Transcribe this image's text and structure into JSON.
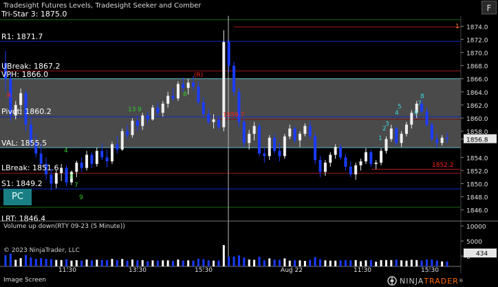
{
  "header": {
    "title": "Tradesight Futures Levels, Tradesight Seeker and Comber",
    "f_button": "F"
  },
  "pc_button": "PC",
  "volume_panel": {
    "title": "Volume up down(RTY 09-23 (5 Minute))",
    "axis_labels": [
      "10000",
      "5000",
      "0"
    ],
    "current_volume": "434"
  },
  "copyright": "© 2023 NinjaTrader, LLC",
  "footer": {
    "image_screen": "Image Screen",
    "brand_part_a": "NINJA",
    "brand_part_b": "TRADER",
    "brand_tm": "®"
  },
  "colors": {
    "background": "#000000",
    "band_fill": "#4a4a4a",
    "band_line": "#5fb9c9",
    "red_line": "#9a1a1a",
    "blue_line": "#0a2cc8",
    "green_line": "#1a6a1a",
    "bar_up": "#f0f0f0",
    "bar_down": "#1a3cff",
    "seeker_green": "#2ecc2e",
    "seeker_cyan": "#3ad7e0",
    "label_red": "#ff2020"
  },
  "levels": [
    {
      "label": "Tri-Star 3: 1875.0",
      "color": "green"
    },
    {
      "label": "R1: 1871.7",
      "color": "blue"
    },
    {
      "label": "UBreak: 1867.2",
      "color": "red"
    },
    {
      "label": "VPH: 1866.0",
      "color": "band"
    },
    {
      "label": "Pivot: 1860.2",
      "color": "blue"
    },
    {
      "label": "VAL: 1855.5",
      "color": "band"
    },
    {
      "label": "LBreak: 1851.6",
      "color": "red"
    },
    {
      "label": "S1: 1849.2",
      "color": "blue"
    },
    {
      "label": "LRT: 1846.4",
      "color": "green"
    }
  ],
  "chart_data": {
    "type": "candlestick",
    "instrument": "RTY 09-23 (5 Minute)",
    "ylim": [
      1844.5,
      1875.6
    ],
    "y_ticks": [
      "1874.0",
      "1872.0",
      "1870.0",
      "1868.0",
      "1866.0",
      "1864.0",
      "1862.0",
      "1860.0",
      "1858.0",
      "1856.8",
      "1854.0",
      "1852.0",
      "1850.0",
      "1848.0",
      "1846.0"
    ],
    "x_ticks": [
      "11:30",
      "13:30",
      "15:30",
      "Aug 22",
      "11:30",
      "13:30",
      "15:30"
    ],
    "current_price": "1856.8",
    "ohlc": [
      [
        1868.4,
        1870.2,
        1864.0,
        1866.0
      ],
      [
        1866.0,
        1866.8,
        1859.5,
        1860.4
      ],
      [
        1860.4,
        1862.6,
        1859.8,
        1862.0
      ],
      [
        1862.0,
        1864.5,
        1860.5,
        1863.8
      ],
      [
        1863.8,
        1864.3,
        1858.0,
        1859.0
      ],
      [
        1859.0,
        1860.1,
        1855.5,
        1856.2
      ],
      [
        1856.2,
        1857.5,
        1854.0,
        1854.6
      ],
      [
        1854.6,
        1856.2,
        1852.2,
        1853.0
      ],
      [
        1853.0,
        1854.0,
        1850.5,
        1851.4
      ],
      [
        1851.4,
        1852.3,
        1849.0,
        1850.0
      ],
      [
        1850.0,
        1852.0,
        1849.3,
        1851.6
      ],
      [
        1851.6,
        1853.0,
        1850.4,
        1852.4
      ],
      [
        1852.4,
        1852.8,
        1849.6,
        1850.2
      ],
      [
        1850.2,
        1852.0,
        1849.8,
        1851.8
      ],
      [
        1851.8,
        1853.5,
        1851.0,
        1853.2
      ],
      [
        1853.2,
        1854.0,
        1851.8,
        1852.4
      ],
      [
        1852.4,
        1855.0,
        1852.0,
        1854.4
      ],
      [
        1854.4,
        1854.8,
        1852.4,
        1853.0
      ],
      [
        1853.0,
        1855.5,
        1852.6,
        1855.0
      ],
      [
        1855.0,
        1856.2,
        1853.6,
        1854.0
      ],
      [
        1854.0,
        1855.2,
        1852.5,
        1853.4
      ],
      [
        1853.4,
        1856.4,
        1853.0,
        1856.0
      ],
      [
        1856.0,
        1857.2,
        1854.6,
        1855.2
      ],
      [
        1855.2,
        1858.4,
        1855.0,
        1858.0
      ],
      [
        1858.0,
        1859.0,
        1856.8,
        1857.4
      ],
      [
        1857.4,
        1860.0,
        1857.0,
        1859.6
      ],
      [
        1859.6,
        1860.4,
        1858.0,
        1858.8
      ],
      [
        1858.8,
        1860.8,
        1858.2,
        1860.4
      ],
      [
        1860.4,
        1861.0,
        1859.2,
        1859.8
      ],
      [
        1859.8,
        1862.0,
        1859.6,
        1861.6
      ],
      [
        1861.6,
        1862.4,
        1860.2,
        1860.8
      ],
      [
        1860.8,
        1862.6,
        1860.2,
        1862.2
      ],
      [
        1862.2,
        1864.0,
        1861.6,
        1863.4
      ],
      [
        1863.4,
        1864.6,
        1862.6,
        1863.0
      ],
      [
        1863.0,
        1865.6,
        1862.6,
        1865.2
      ],
      [
        1865.2,
        1866.2,
        1864.0,
        1864.6
      ],
      [
        1864.6,
        1866.0,
        1863.6,
        1865.4
      ],
      [
        1865.4,
        1866.4,
        1864.2,
        1864.8
      ],
      [
        1864.8,
        1865.6,
        1862.0,
        1862.4
      ],
      [
        1862.4,
        1863.2,
        1860.0,
        1860.6
      ],
      [
        1860.6,
        1861.4,
        1859.0,
        1859.4
      ],
      [
        1859.4,
        1860.6,
        1858.4,
        1859.8
      ],
      [
        1859.8,
        1860.4,
        1858.2,
        1858.6
      ],
      [
        1858.6,
        1873.4,
        1858.0,
        1871.6
      ],
      [
        1871.6,
        1872.0,
        1867.0,
        1868.0
      ],
      [
        1868.0,
        1868.6,
        1863.4,
        1864.0
      ],
      [
        1864.0,
        1864.6,
        1858.6,
        1859.4
      ],
      [
        1859.4,
        1860.0,
        1855.6,
        1856.2
      ],
      [
        1856.2,
        1858.2,
        1855.2,
        1857.6
      ],
      [
        1857.6,
        1859.4,
        1856.6,
        1858.8
      ],
      [
        1858.8,
        1859.2,
        1854.2,
        1854.6
      ],
      [
        1854.6,
        1855.6,
        1853.2,
        1854.2
      ],
      [
        1854.2,
        1857.4,
        1853.6,
        1857.0
      ],
      [
        1857.0,
        1857.6,
        1854.6,
        1855.0
      ],
      [
        1855.0,
        1856.2,
        1853.4,
        1854.2
      ],
      [
        1854.2,
        1857.6,
        1853.8,
        1857.2
      ],
      [
        1857.2,
        1859.0,
        1856.8,
        1858.4
      ],
      [
        1858.4,
        1858.8,
        1856.2,
        1856.6
      ],
      [
        1856.6,
        1858.0,
        1855.6,
        1857.6
      ],
      [
        1857.6,
        1859.2,
        1857.2,
        1858.8
      ],
      [
        1858.8,
        1859.6,
        1856.8,
        1857.2
      ],
      [
        1857.2,
        1857.8,
        1853.0,
        1853.6
      ],
      [
        1853.6,
        1854.2,
        1851.0,
        1851.8
      ],
      [
        1851.8,
        1853.6,
        1851.2,
        1853.2
      ],
      [
        1853.2,
        1854.8,
        1852.6,
        1854.4
      ],
      [
        1854.4,
        1856.0,
        1853.8,
        1855.6
      ],
      [
        1855.6,
        1856.0,
        1853.6,
        1854.0
      ],
      [
        1854.0,
        1854.6,
        1852.0,
        1852.6
      ],
      [
        1852.6,
        1853.4,
        1851.0,
        1851.4
      ],
      [
        1851.4,
        1853.2,
        1850.6,
        1852.8
      ],
      [
        1852.8,
        1853.8,
        1852.0,
        1853.4
      ],
      [
        1853.4,
        1855.4,
        1853.0,
        1854.8
      ],
      [
        1854.8,
        1855.2,
        1852.6,
        1853.0
      ],
      [
        1853.0,
        1853.6,
        1852.2,
        1853.2
      ],
      [
        1853.2,
        1855.4,
        1852.8,
        1855.0
      ],
      [
        1855.0,
        1857.2,
        1854.6,
        1856.8
      ],
      [
        1856.8,
        1859.0,
        1856.4,
        1858.4
      ],
      [
        1858.4,
        1858.8,
        1855.8,
        1856.2
      ],
      [
        1856.2,
        1858.0,
        1855.6,
        1857.6
      ],
      [
        1857.6,
        1859.4,
        1857.2,
        1859.0
      ],
      [
        1859.0,
        1861.2,
        1858.4,
        1860.8
      ],
      [
        1860.8,
        1862.6,
        1860.0,
        1862.2
      ],
      [
        1862.2,
        1862.8,
        1860.6,
        1861.0
      ],
      [
        1861.0,
        1861.6,
        1858.6,
        1859.0
      ],
      [
        1859.0,
        1859.4,
        1856.4,
        1856.8
      ],
      [
        1856.8,
        1857.6,
        1855.4,
        1856.2
      ],
      [
        1856.2,
        1857.4,
        1855.8,
        1857.0
      ],
      [
        1857.0,
        1857.8,
        1856.2,
        1856.8
      ]
    ]
  }
}
